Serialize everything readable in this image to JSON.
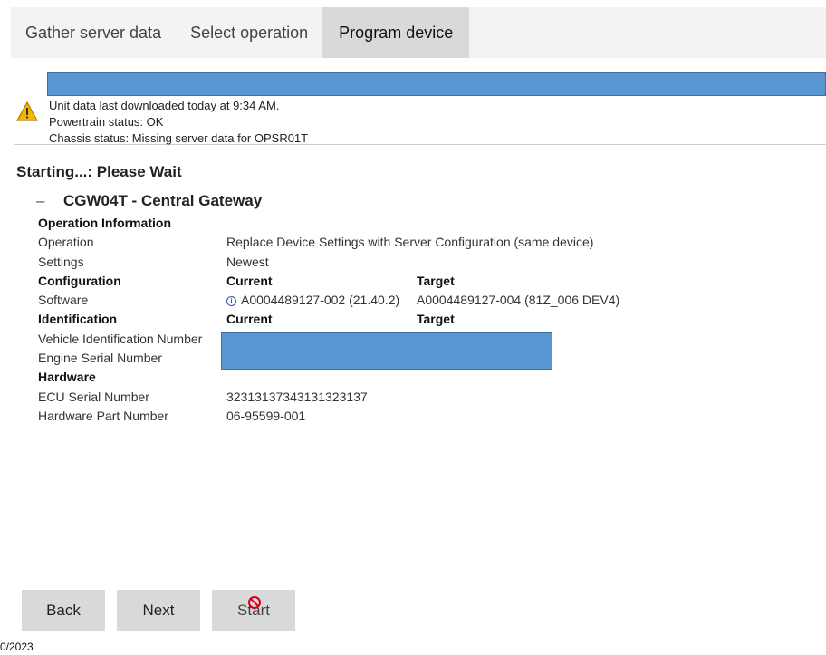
{
  "tabs": [
    {
      "label": "Gather server data",
      "active": false
    },
    {
      "label": "Select operation",
      "active": false
    },
    {
      "label": "Program device",
      "active": true
    }
  ],
  "status": {
    "line1": "Unit data last downloaded today at 9:34 AM.",
    "line2": "Powertrain status: OK",
    "line3": "Chassis status: Missing server data for OPSR01T",
    "icon": "warning-icon",
    "icon_color": "#e6a100"
  },
  "progress_fill": 1.0,
  "starting_text": "Starting...: Please Wait",
  "device": {
    "collapse_symbol": "–",
    "title": "CGW04T - Central Gateway",
    "rows": [
      {
        "c1": "Operation Information",
        "c2": "",
        "c3": "",
        "bold": true
      },
      {
        "c1": "Operation",
        "c2": "Replace Device Settings with Server Configuration (same device)",
        "c3": "",
        "bold": false
      },
      {
        "c1": "Settings",
        "c2": "Newest",
        "c3": "",
        "bold": false
      },
      {
        "c1": "Configuration",
        "c2": "Current",
        "c3": "Target",
        "bold": true
      },
      {
        "c1": "Software",
        "c2": "A0004489127-002 (21.40.2)",
        "c3": "A0004489127-004 (81Z_006 DEV4)",
        "bold": false,
        "info": true
      },
      {
        "c1": "Identification",
        "c2": "Current",
        "c3": "Target",
        "bold": true
      },
      {
        "c1": "Vehicle Identification Number",
        "c2": "",
        "c3": "",
        "bold": false
      },
      {
        "c1": "Engine Serial Number",
        "c2": "",
        "c3": "",
        "bold": false
      },
      {
        "c1": "Hardware",
        "c2": "",
        "c3": "",
        "bold": true
      },
      {
        "c1": "ECU Serial Number",
        "c2": "32313137343131323137",
        "c3": "",
        "bold": false
      },
      {
        "c1": "Hardware Part Number",
        "c2": "06-95599-001",
        "c3": "",
        "bold": false
      }
    ]
  },
  "buttons": {
    "back": "Back",
    "next": "Next",
    "start": "Start"
  },
  "footer_date": "0/2023",
  "colors": {
    "accent_blue": "#5a96d2",
    "tab_active": "#d9d9d9",
    "button_bg": "#d9d9d9",
    "no_symbol": "#d0021b"
  }
}
